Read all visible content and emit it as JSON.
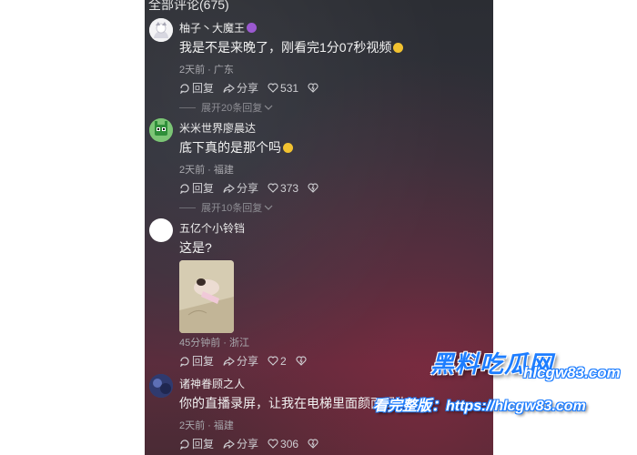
{
  "header": {
    "title": "全部评论(675)"
  },
  "comments": [
    {
      "username": "柚子丶大魔王",
      "text": "我是不是来晚了，刚看完1分07秒视频",
      "meta": "2天前 · 广东",
      "reply_label": "回复",
      "share_label": "分享",
      "like_count": "531",
      "expand_label": "展开20条回复"
    },
    {
      "username": "米米世界廖晨达",
      "text": "底下真的是那个吗",
      "meta": "2天前 · 福建",
      "reply_label": "回复",
      "share_label": "分享",
      "like_count": "373",
      "expand_label": "展开10条回复"
    },
    {
      "username": "五亿个小铃铛",
      "text": "这是?",
      "meta": "45分钟前 · 浙江",
      "reply_label": "回复",
      "share_label": "分享",
      "like_count": "2"
    },
    {
      "username": "诸神眷顾之人",
      "text": "你的直播录屏，让我在电梯里面颜面尽失",
      "meta": "2天前 · 福建",
      "reply_label": "回复",
      "share_label": "分享",
      "like_count": "306"
    }
  ],
  "watermark": {
    "logo": "黑料吃瓜网",
    "domain": "hlcgw83.com",
    "url_line": "看完整版：https://hlcgw83.com"
  },
  "colors": {
    "brand_blue": "#1d7dff",
    "badge_purple": "#9b59d0",
    "avatar_green": "#4caf50"
  },
  "icons": [
    "reply-icon",
    "share-icon",
    "heart-icon",
    "dislike-icon",
    "chevron-down-icon"
  ]
}
